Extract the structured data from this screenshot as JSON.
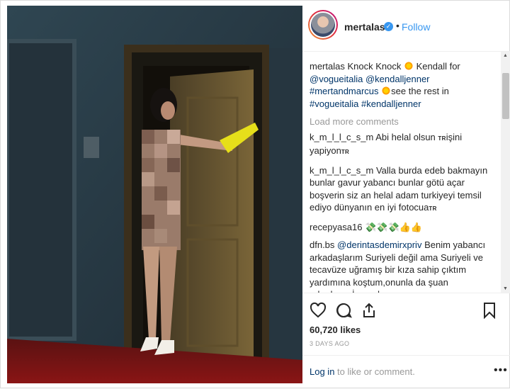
{
  "post": {
    "username": "mertalas",
    "follow_label": "Follow",
    "separator": "•"
  },
  "caption": {
    "username": "mertalas",
    "parts": {
      "a": "Knock Knock",
      "b": "Kendall for",
      "m1": "@vogueitalia",
      "m2": "@kendalljenner",
      "h1": "#mertandmarcus",
      "c": "see the rest in",
      "h2": "#vogueitalia",
      "h3": "#kendalljenner"
    }
  },
  "load_more": "Load more comments",
  "comments": [
    {
      "user": "k_m_l_l_c_s_m",
      "text": "Abi helal olsun",
      "tag": "TR",
      "text2": "işini yapiyon",
      "tag2": "TR"
    },
    {
      "user": "k_m_l_l_c_s_m",
      "text": "Valla burda edeb bakmayın bunlar gavur yabancı bunlar götü açar boşverin siz an helal adam turkiyeyi temsil ediyo dünyanın en iyi fotocua",
      "tag": "TR"
    },
    {
      "user": "recepyasa16",
      "text": ""
    },
    {
      "user": "dfn.bs",
      "mention": "@derintasdemirxpriv",
      "text": "Benim yabancı arkadaşlarım Suriyeli değil ama Suriyeli ve tecavüze uğramış bir kıza sahip çıktım yardımına koştum,onunla da şuan arkadaşız.İnsandan saymıyorsan"
    }
  ],
  "actions": {
    "icons": [
      "heart-icon",
      "comment-icon",
      "share-icon",
      "bookmark-icon"
    ],
    "likes": "60,720 likes",
    "time": "3 DAYS AGO"
  },
  "footer": {
    "login": "Log in",
    "rest": "to like or comment.",
    "more": "•••"
  },
  "colors": {
    "link": "#003569",
    "accent": "#3897f0",
    "muted": "#999999"
  }
}
